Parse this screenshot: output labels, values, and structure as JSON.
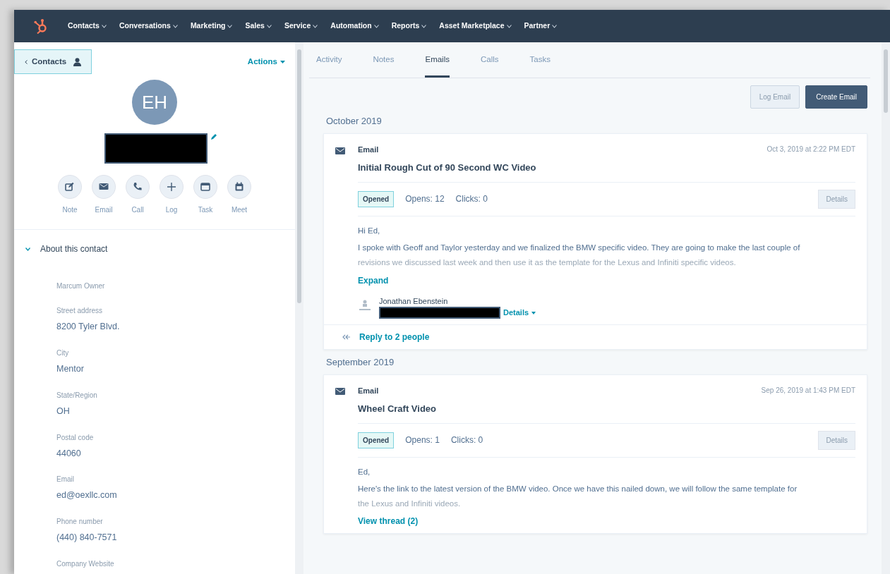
{
  "nav": {
    "items": [
      {
        "label": "Contacts"
      },
      {
        "label": "Conversations"
      },
      {
        "label": "Marketing"
      },
      {
        "label": "Sales"
      },
      {
        "label": "Service"
      },
      {
        "label": "Automation"
      },
      {
        "label": "Reports"
      },
      {
        "label": "Asset Marketplace"
      },
      {
        "label": "Partner"
      }
    ]
  },
  "contact_panel": {
    "back_button": "Contacts",
    "actions": "Actions",
    "avatar_initials": "EH",
    "quick_actions": [
      {
        "label": "Note",
        "kind": "note"
      },
      {
        "label": "Email",
        "kind": "email"
      },
      {
        "label": "Call",
        "kind": "call"
      },
      {
        "label": "Log",
        "kind": "log"
      },
      {
        "label": "Task",
        "kind": "task"
      },
      {
        "label": "Meet",
        "kind": "meet"
      }
    ],
    "section": {
      "title": "About this contact",
      "expanded": true
    },
    "properties": [
      {
        "label": "Marcum Owner"
      },
      {
        "label": "Street address",
        "value": "8200 Tyler Blvd."
      },
      {
        "label": "City",
        "value": "Mentor"
      },
      {
        "label": "State/Region",
        "value": "OH"
      },
      {
        "label": "Postal code",
        "value": "44060"
      },
      {
        "label": "Email",
        "value": "ed@oexllc.com"
      },
      {
        "label": "Phone number",
        "value": "(440) 840-7571"
      },
      {
        "label": "Company Website"
      }
    ]
  },
  "tabs": [
    {
      "label": "Activity",
      "selected": false
    },
    {
      "label": "Notes",
      "selected": false
    },
    {
      "label": "Emails",
      "selected": true
    },
    {
      "label": "Calls",
      "selected": false
    },
    {
      "label": "Tasks",
      "selected": false
    }
  ],
  "buttons": {
    "log_email": "Log Email",
    "create_email": "Create Email"
  },
  "groups": [
    {
      "month": "October 2019",
      "emails": [
        {
          "type_label": "Email",
          "timestamp": "Oct 3, 2019 at 2:22 PM EDT",
          "subject": "Initial Rough Cut of 90 Second WC Video",
          "status": "Opened",
          "opens_label": "Opens:",
          "opens": "12",
          "clicks_label": "Clicks:",
          "clicks": "0",
          "details": "Details",
          "greeting": "Hi Ed,",
          "body_lines": [
            "I spoke with Geoff and Taylor yesterday and we finalized the BMW specific video. They are going to make the last couple of",
            "revisions we discussed last week and then use it as the template for the Lexus and Infiniti specific videos."
          ],
          "more_link": "Expand",
          "sender": {
            "name": "Jonathan Ebenstein",
            "details": "Details"
          },
          "reply_link": "Reply to 2 people"
        }
      ]
    },
    {
      "month": "September 2019",
      "emails": [
        {
          "type_label": "Email",
          "timestamp": "Sep 26, 2019 at 1:43 PM EDT",
          "subject": "Wheel Craft Video",
          "status": "Opened",
          "opens_label": "Opens:",
          "opens": "1",
          "clicks_label": "Clicks:",
          "clicks": "0",
          "details": "Details",
          "greeting": "Ed,",
          "body_lines": [
            "Here's the link to the latest version of the BMW video. Once we have this nailed down, we will follow the same template for",
            "the Lexus and Infiniti videos."
          ],
          "more_link": "View thread (2)"
        }
      ]
    }
  ]
}
